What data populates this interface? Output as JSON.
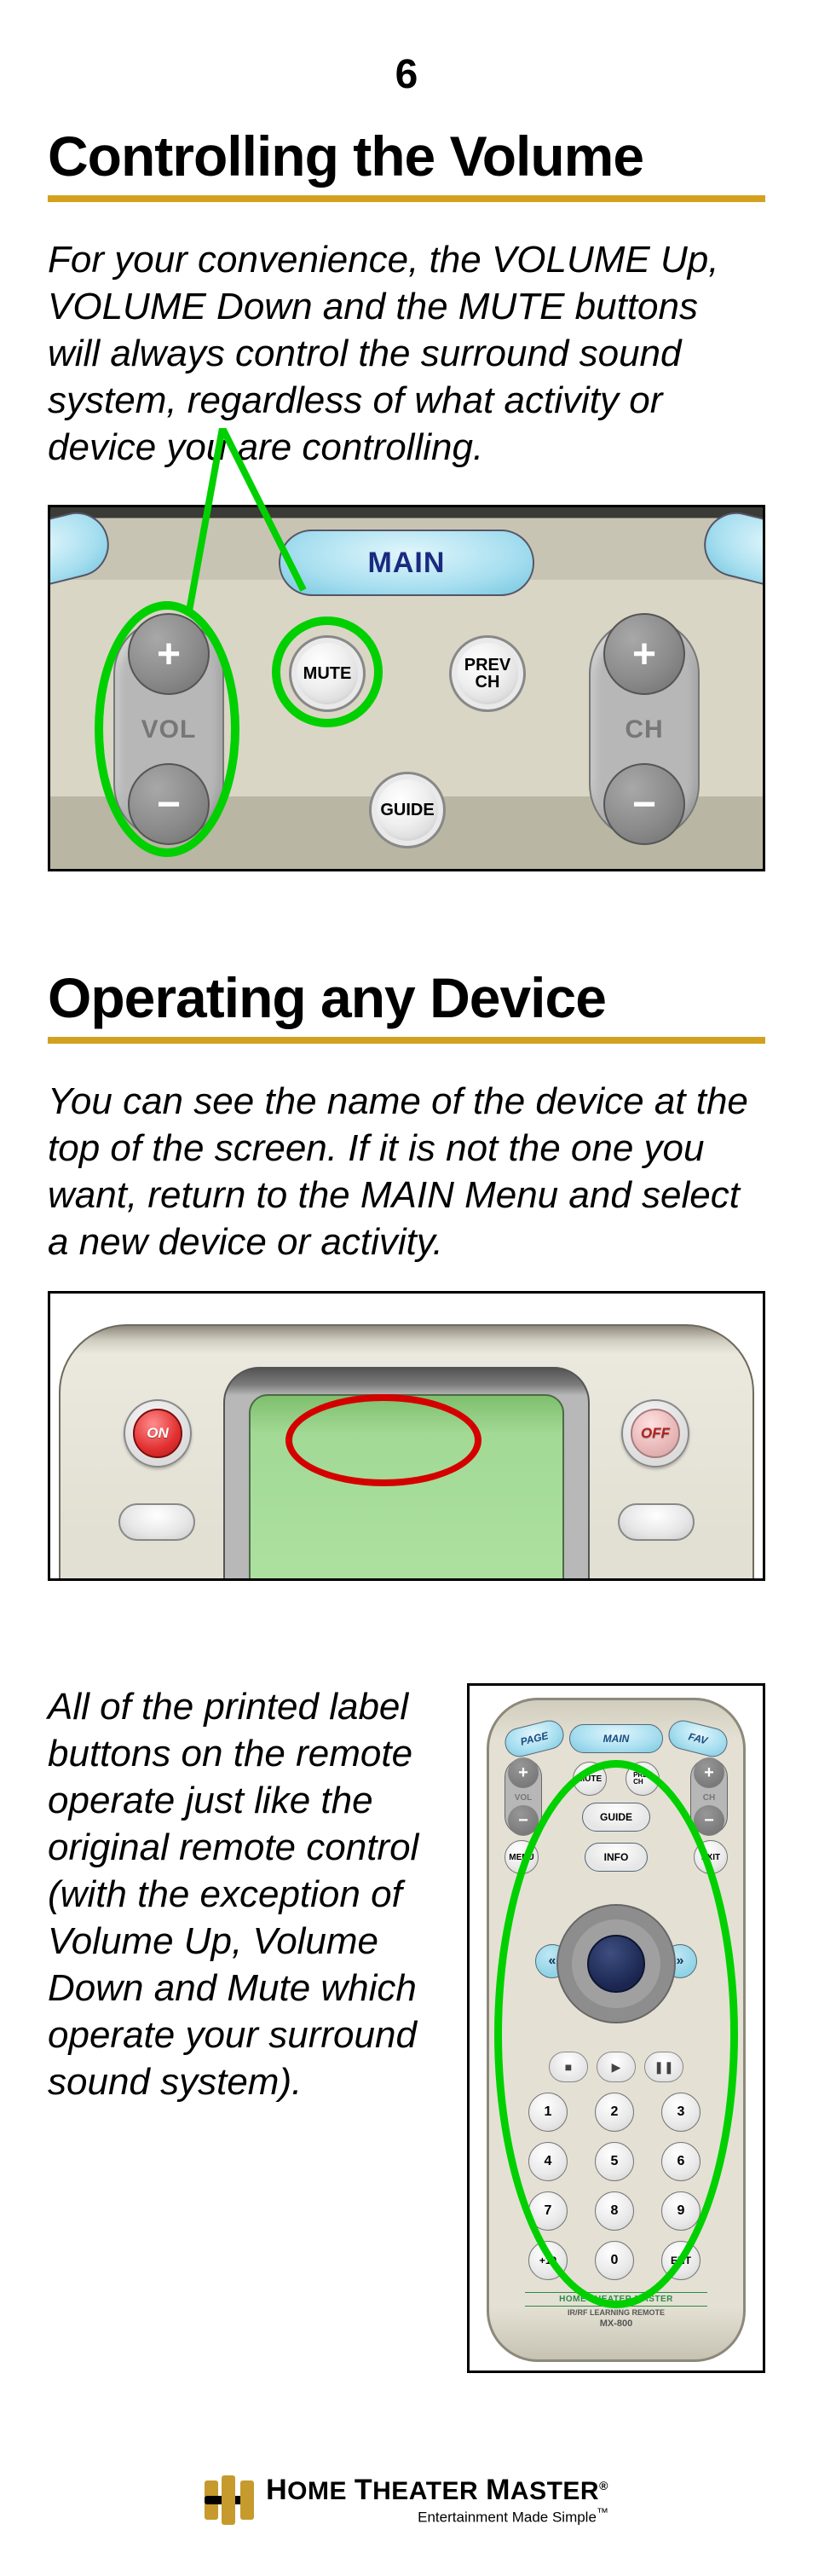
{
  "page_number": "6",
  "sections": {
    "s1": {
      "title": "Controlling the Volume",
      "intro": "For your convenience, the VOLUME Up, VOLUME Down and the MUTE buttons will always control the surround sound system, regardless of what activity or device you are controlling."
    },
    "s2": {
      "title": "Operating any Device",
      "intro": "You can see the name of the device at the top of the screen. If it is not the one you want, return to the MAIN Menu and select a new device or activity."
    },
    "s3": {
      "para": "All of the printed label buttons on the remote operate just like the original remote control (with the exception of Volume Up, Volume Down and Mute which operate your surround sound system)."
    }
  },
  "fig1": {
    "main": "MAIN",
    "mute": "MUTE",
    "prev_ch": "PREV\nCH",
    "guide": "GUIDE",
    "vol_label": "VOL",
    "ch_label": "CH",
    "plus": "+",
    "minus": "−"
  },
  "fig2": {
    "on": "ON",
    "off": "OFF"
  },
  "fig3": {
    "page": "PAGE",
    "main": "MAIN",
    "fav": "FAV",
    "mute": "MUTE",
    "prev": "PREV\nCH",
    "guide": "GUIDE",
    "menu": "MENU",
    "info": "INFO",
    "exit": "EXIT",
    "vol": "VOL",
    "ch": "CH",
    "stop": "■",
    "play": "▶",
    "pause": "❚❚",
    "left": "«",
    "right": "»",
    "nums": [
      "1",
      "2",
      "3",
      "4",
      "5",
      "6",
      "7",
      "8",
      "9",
      "+10",
      "0",
      "ENT"
    ],
    "brand": "HOME THEATER MASTER",
    "subbrand": "IR/RF LEARNING REMOTE",
    "model": "MX-800"
  },
  "footer": {
    "brand_1a": "H",
    "brand_1b": "OME",
    "brand_1c": "T",
    "brand_1d": "HEATER",
    "brand_1e": "M",
    "brand_1f": "ASTER",
    "reg": "®",
    "tagline": "Entertainment Made Simple",
    "tm": "™"
  }
}
